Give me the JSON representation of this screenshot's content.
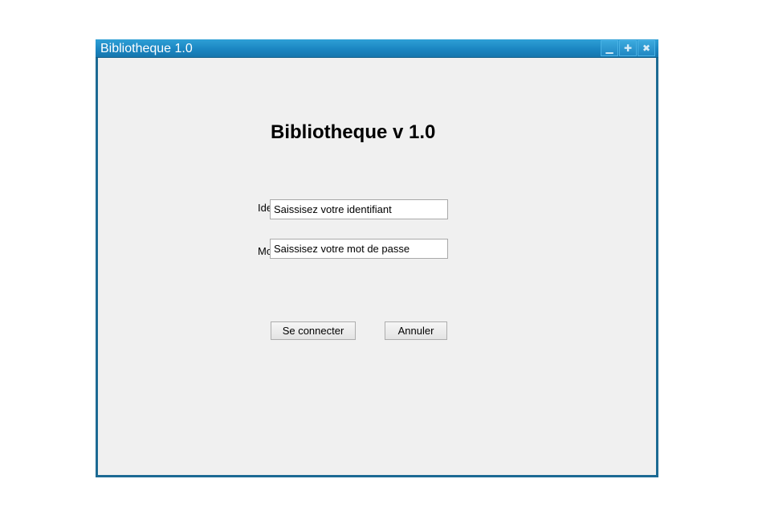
{
  "window": {
    "title": "Bibliotheque 1.0",
    "controls": {
      "minimize_glyph": "▁",
      "maximize_glyph": "✚",
      "close_glyph": "✖"
    }
  },
  "app": {
    "title": "Bibliotheque v 1.0"
  },
  "form": {
    "identifier": {
      "label": "Identifiant",
      "value": "Saissisez votre identifiant"
    },
    "password": {
      "label": "Mot de passe",
      "value": "Saissisez votre mot de passe"
    },
    "connect_label": "Se connecter",
    "cancel_label": "Annuler"
  },
  "colors": {
    "title_bar": "#1b86c2",
    "window_border": "#1c6a93",
    "content_background": "#f0f0f0"
  }
}
